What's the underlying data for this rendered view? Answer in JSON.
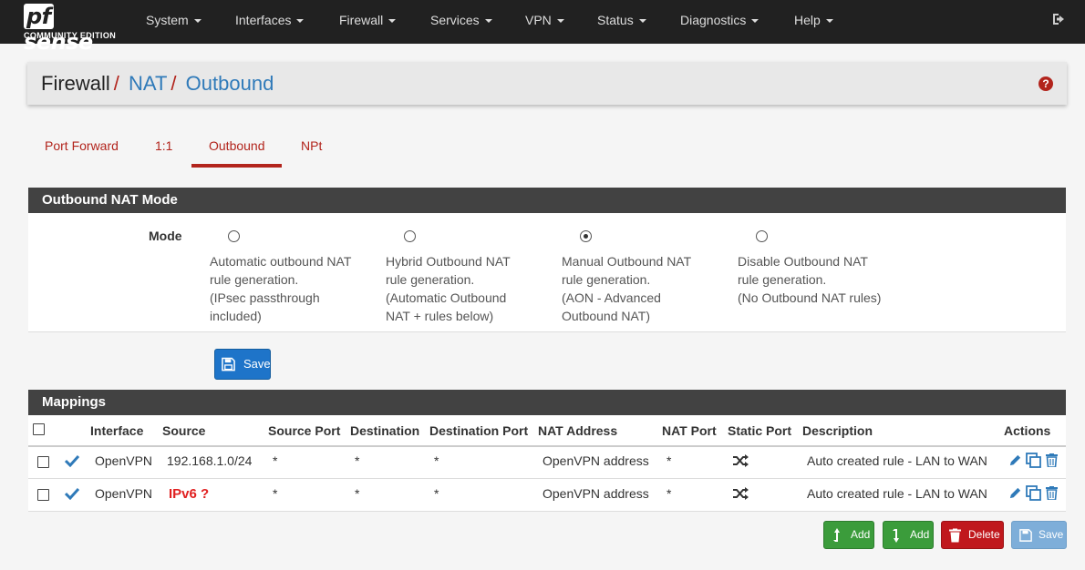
{
  "brand": {
    "name_prefix": "pf",
    "name_suffix": "sense",
    "edition": "COMMUNITY EDITION"
  },
  "nav": {
    "items": [
      "System",
      "Interfaces",
      "Firewall",
      "Services",
      "VPN",
      "Status",
      "Diagnostics",
      "Help"
    ],
    "logout_icon": "sign-out-icon"
  },
  "breadcrumb": {
    "root": "Firewall",
    "sep": "/",
    "level1": "NAT",
    "level2": "Outbound"
  },
  "tabs": [
    "Port Forward",
    "1:1",
    "Outbound",
    "NPt"
  ],
  "active_tab": "Outbound",
  "outbound_mode": {
    "title": "Outbound NAT Mode",
    "mode_label": "Mode",
    "options": [
      {
        "lines": [
          "Automatic outbound NAT",
          "rule generation.",
          "(IPsec passthrough",
          "included)"
        ],
        "selected": false
      },
      {
        "lines": [
          "Hybrid Outbound NAT",
          "rule generation.",
          "(Automatic Outbound",
          "NAT + rules below)"
        ],
        "selected": false
      },
      {
        "lines": [
          "Manual Outbound NAT",
          "rule generation.",
          "(AON - Advanced",
          "Outbound NAT)"
        ],
        "selected": true
      },
      {
        "lines": [
          "Disable Outbound NAT",
          "rule generation.",
          "(No Outbound NAT rules)"
        ],
        "selected": false
      }
    ],
    "save_label": "Save"
  },
  "mappings": {
    "title": "Mappings",
    "columns": [
      "Interface",
      "Source",
      "Source Port",
      "Destination",
      "Destination Port",
      "NAT Address",
      "NAT Port",
      "Static Port",
      "Description",
      "Actions"
    ],
    "rows": [
      {
        "interface": "OpenVPN",
        "source": "192.168.1.0/24",
        "source_port": "*",
        "destination": "*",
        "destination_port": "*",
        "nat_address": "OpenVPN address",
        "nat_port": "*",
        "description": "Auto created rule - LAN to WAN"
      },
      {
        "interface": "OpenVPN",
        "source": "IPv6 ?",
        "source_port": "*",
        "destination": "*",
        "destination_port": "*",
        "nat_address": "OpenVPN address",
        "nat_port": "*",
        "description": "Auto created rule - LAN to WAN"
      }
    ],
    "buttons": {
      "add_top": "Add",
      "add_bottom": "Add",
      "delete": "Delete",
      "save": "Save"
    }
  },
  "colors": {
    "brand_red": "#b2241c",
    "link_blue": "#2f7ab9",
    "navbar": "#212121",
    "panel_heading": "#424242"
  }
}
